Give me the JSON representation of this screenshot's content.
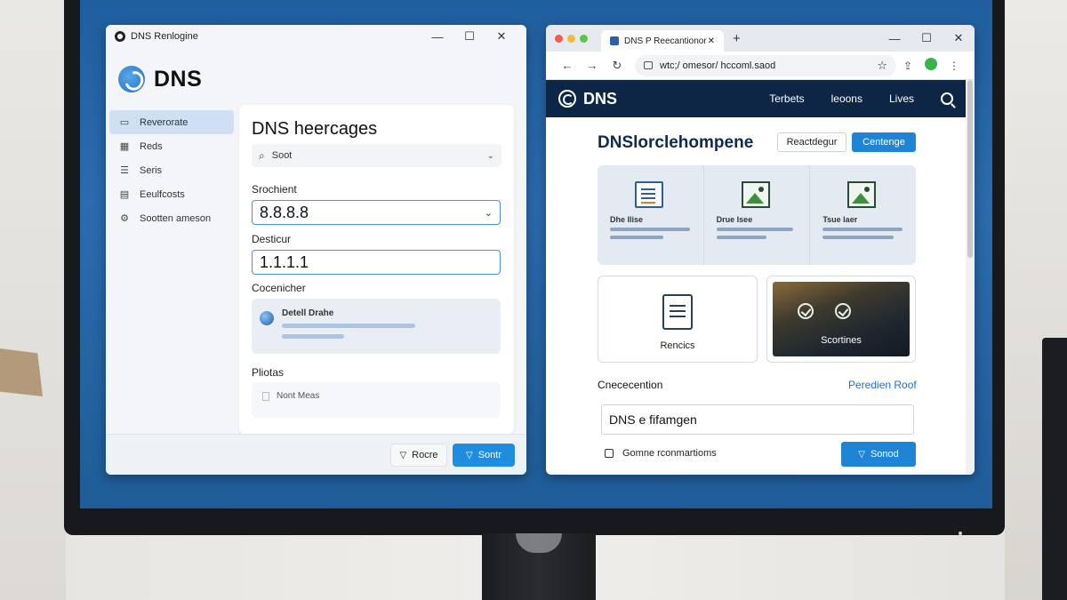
{
  "app_window": {
    "title": "DNS Renlogine",
    "controls": {
      "minimize": "—",
      "maximize": "☐",
      "close": "✕"
    },
    "brand": "DNS",
    "sidebar": {
      "items": [
        {
          "label": "Reverorate",
          "icon": "window-icon",
          "active": true
        },
        {
          "label": "Reds",
          "icon": "grid-icon",
          "active": false
        },
        {
          "label": "Seris",
          "icon": "list-icon",
          "active": false
        },
        {
          "label": "Eeulfcosts",
          "icon": "calendar-icon",
          "active": false
        },
        {
          "label": "Sootten ameson",
          "icon": "gear-icon",
          "active": false
        }
      ]
    },
    "panel": {
      "title": "DNS heercages",
      "search_value": "Soot",
      "primary_label": "Srochient",
      "primary_value": "8.8.8.8",
      "secondary_label": "Desticur",
      "secondary_value": "1.1.1.1",
      "section_label": "Cocenicher",
      "card_title": "Detell Drahe",
      "notes_label": "Pliotas",
      "notes_item": "Nont Meas"
    },
    "footer": {
      "ghost_button": "Rocre",
      "primary_button": "Sontr"
    }
  },
  "browser": {
    "tab_title": "DNS P Reecantionor",
    "tab_close": "✕",
    "new_tab": "+",
    "controls": {
      "minimize": "—",
      "maximize": "☐",
      "close": "✕"
    },
    "url": "wtc;/ omesor/ hccoml.saod",
    "site": {
      "brand": "DNS",
      "nav_links": [
        "Terbets",
        "leoons",
        "Lives"
      ],
      "hero_title": "DNSlorclehompene",
      "button_outline": "Reactdegur",
      "button_solid": "Centenge",
      "gallery": [
        {
          "title": "Dhe Ilise",
          "icon": "document-icon"
        },
        {
          "title": "Drue Isee",
          "icon": "image-icon"
        },
        {
          "title": "Tsue laer",
          "icon": "image-icon"
        }
      ],
      "card_left_label": "Rencics",
      "card_right_label": "Scortines",
      "section_title": "Cnececention",
      "section_link": "Peredien Roof",
      "input_value": "DNS e fifamgen",
      "footer_text": "Gomne rconmartioms",
      "footer_button": "Sonod"
    }
  },
  "colors": {
    "accent": "#1f8ddf",
    "site_nav": "#0d2646",
    "screen_bg": "#2a6cae"
  }
}
